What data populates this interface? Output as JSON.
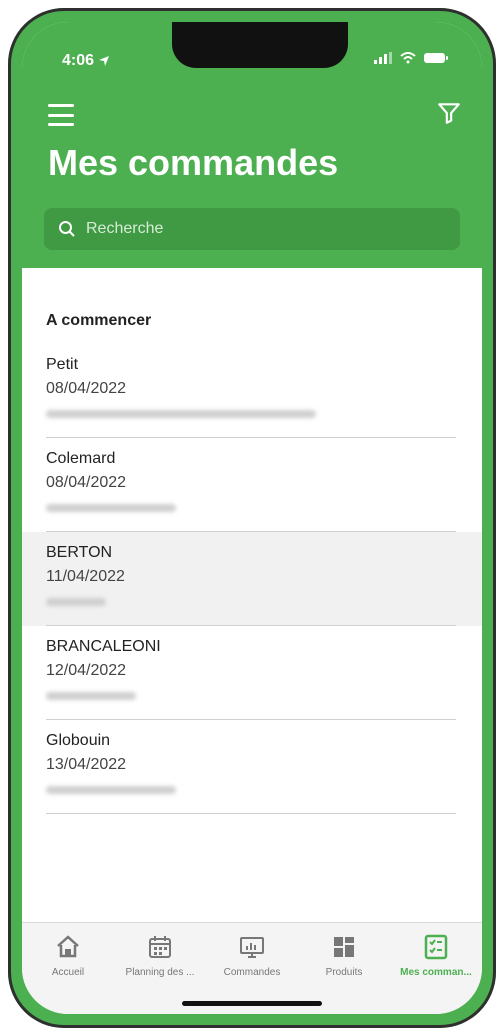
{
  "status": {
    "time": "4:06"
  },
  "header": {
    "title": "Mes commandes"
  },
  "search": {
    "placeholder": "Recherche"
  },
  "section": {
    "title": "A commencer"
  },
  "orders": [
    {
      "name": "Petit",
      "date": "08/04/2022"
    },
    {
      "name": "Colemard",
      "date": "08/04/2022"
    },
    {
      "name": "BERTON",
      "date": "11/04/2022"
    },
    {
      "name": "BRANCALEONI",
      "date": "12/04/2022"
    },
    {
      "name": "Globouin",
      "date": "13/04/2022"
    }
  ],
  "tabs": [
    {
      "label": "Accueil",
      "icon": "home-icon"
    },
    {
      "label": "Planning des ...",
      "icon": "calendar-icon"
    },
    {
      "label": "Commandes",
      "icon": "monitor-chart-icon"
    },
    {
      "label": "Produits",
      "icon": "grid-icon"
    },
    {
      "label": "Mes comman...",
      "icon": "checklist-icon"
    }
  ],
  "colors": {
    "accent": "#4caf50",
    "search_bg": "#3f9a43",
    "selected_row": "#f1f1f1"
  }
}
